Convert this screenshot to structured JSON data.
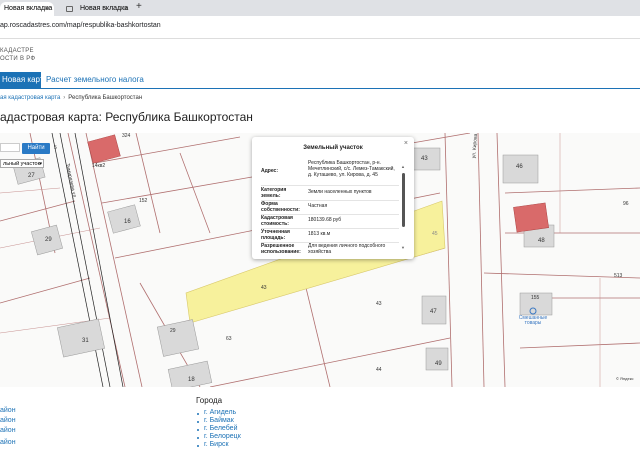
{
  "browser": {
    "tabs": [
      {
        "label": "Новая вкладка",
        "active": true
      },
      {
        "label": "Новая вкладка",
        "active": false
      }
    ],
    "url": "ap.roscadastres.com/map/respublika-bashkortostan"
  },
  "site": {
    "logo_line1": "КАДАСТРЕ",
    "logo_line2": "ОСТИ В РФ",
    "nav_active": "Новая карта",
    "nav_link": "Расчет земельного налога",
    "crumb_link": "ая кадастровая карта",
    "crumb_current": "Республика Башкортостан",
    "page_title": "адастровая карта: Республика Башкортостан"
  },
  "search": {
    "button": "Найти",
    "select_value": "льный участок"
  },
  "map": {
    "labels": {
      "l324": "324",
      "l5": "5",
      "l14kv2": "14кв2",
      "l27": "27",
      "street1": "Тимирязева ул.",
      "l152": "152",
      "l16": "16",
      "l29a": "29",
      "l43a": "43",
      "street2": "ул. Кирова",
      "l46": "46",
      "l96": "96",
      "l45": "45",
      "l48": "48",
      "l513": "513",
      "l155": "155",
      "l43b": "43",
      "l43c": "43",
      "l47": "47",
      "l29b": "29",
      "l63": "63",
      "l31": "31",
      "l18": "18",
      "l49": "49",
      "l44": "44",
      "shop": "Смешанные товары",
      "yandex": "© Яндекс"
    },
    "parcel_fill": "#f7f19c",
    "building_red": "#d96a6a"
  },
  "popup": {
    "title": "Земельный участок",
    "rows": [
      {
        "label": "Адрес:",
        "value": "Республика Башкортостан, р-н. Мечетлинский, с/с. Лемез-Тамакский, д. Куташево, ул. Кирова, д. 45"
      },
      {
        "label": "Категория земель:",
        "value": "Земли населенных пунктов"
      },
      {
        "label": "Форма собственности:",
        "value": "Частная"
      },
      {
        "label": "Кадастровая стоимость:",
        "value": "180139.68 руб"
      },
      {
        "label": "Уточненная площадь:",
        "value": "1813 кв.м"
      },
      {
        "label": "Разрешенное использование:",
        "value": "Для ведения личного подсобного хозяйства"
      }
    ]
  },
  "below": {
    "regions": [
      "айон",
      "айон",
      "айон",
      "айон"
    ],
    "cities_heading": "Города",
    "cities": [
      "г. Агидель",
      "г. Баймак",
      "г. Белебей",
      "г. Белорецк",
      "г. Бирск"
    ]
  }
}
